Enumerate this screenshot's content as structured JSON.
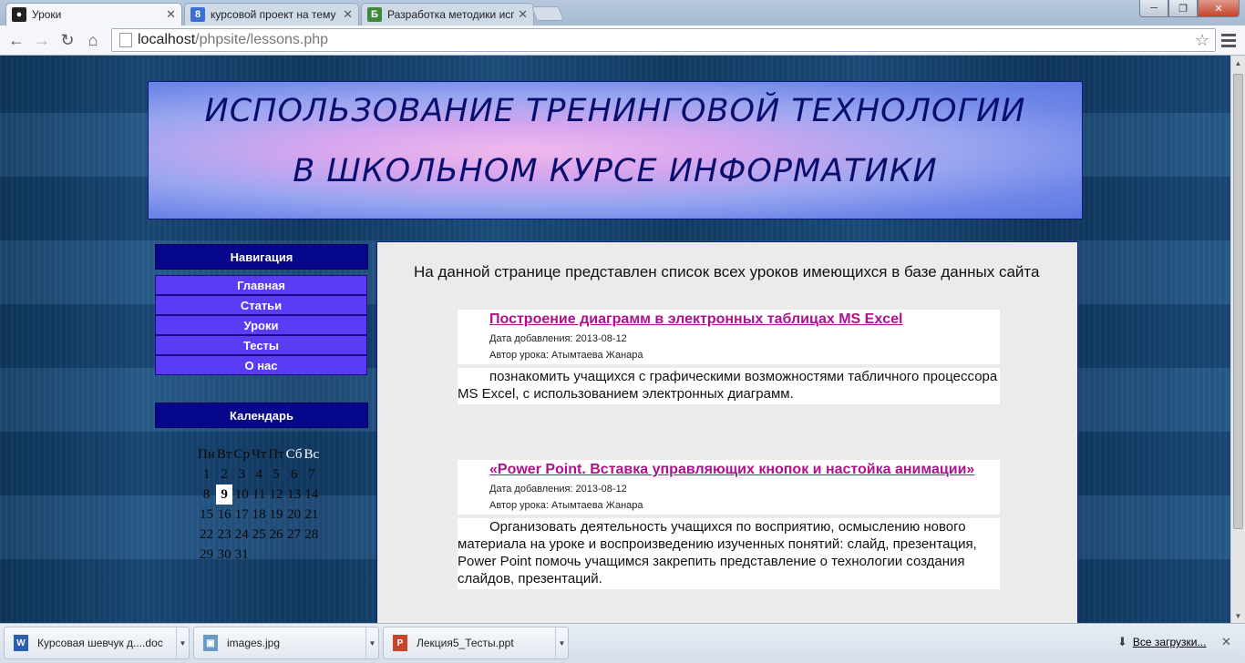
{
  "browser": {
    "tabs": [
      {
        "title": "Уроки",
        "favicon": "spy-icon",
        "active": true
      },
      {
        "title": "курсовой проект на тему",
        "favicon": "google-icon",
        "active": false
      },
      {
        "title": "Разработка методики исп",
        "favicon": "b-icon",
        "active": false
      }
    ],
    "url_host": "localhost",
    "url_path": "/phpsite/lessons.php"
  },
  "banner": {
    "line1": "ИСПОЛЬЗОВАНИЕ ТРЕНИНГОВОЙ ТЕХНОЛОГИИ",
    "line2": "В ШКОЛЬНОМ КУРСЕ ИНФОРМАТИКИ"
  },
  "sidebar": {
    "nav_title": "Навигация",
    "nav_items": [
      "Главная",
      "Статьи",
      "Уроки",
      "Тесты",
      "О нас"
    ],
    "calendar_title": "Календарь",
    "weekdays": [
      "Пн",
      "Вт",
      "Ср",
      "Чт",
      "Пт",
      "Сб",
      "Вс"
    ],
    "weeks": [
      [
        "1",
        "2",
        "3",
        "4",
        "5",
        "6",
        "7"
      ],
      [
        "8",
        "9",
        "10",
        "11",
        "12",
        "13",
        "14"
      ],
      [
        "15",
        "16",
        "17",
        "18",
        "19",
        "20",
        "21"
      ],
      [
        "22",
        "23",
        "24",
        "25",
        "26",
        "27",
        "28"
      ],
      [
        "29",
        "30",
        "31",
        "",
        "",
        "",
        ""
      ]
    ],
    "today": "9"
  },
  "content": {
    "intro": "На данной странице представлен список всех уроков имеющихся в базе данных сайта",
    "lessons": [
      {
        "title": "Построение диаграмм в электронных таблицах MS Excel",
        "date": "Дата добавления: 2013-08-12",
        "author": "Автор урока: Атымтаева Жанара",
        "description": "познакомить учащихся с графическими возможностями табличного процессора MS Excel, с использованием электронных диаграмм."
      },
      {
        "title": "«Power Point. Вставка управляющих кнопок и настойка анимации»",
        "date": "Дата добавления: 2013-08-12",
        "author": "Автор урока: Атымтаева Жанара",
        "description": "Организовать деятельность учащихся по восприятию, осмыслению нового материала на уроке и воспроизведению изученных понятий: слайд, презентация, Power Point помочь учащимся закрепить представление о технологии создания слайдов, презентаций."
      }
    ]
  },
  "downloads": {
    "items": [
      {
        "name": "Курсовая шевчук д....doc",
        "icon": "word-doc-icon"
      },
      {
        "name": "images.jpg",
        "icon": "image-file-icon"
      },
      {
        "name": "Лекция5_Тесты.ppt",
        "icon": "powerpoint-icon"
      }
    ],
    "all_label": "Все загрузки..."
  }
}
